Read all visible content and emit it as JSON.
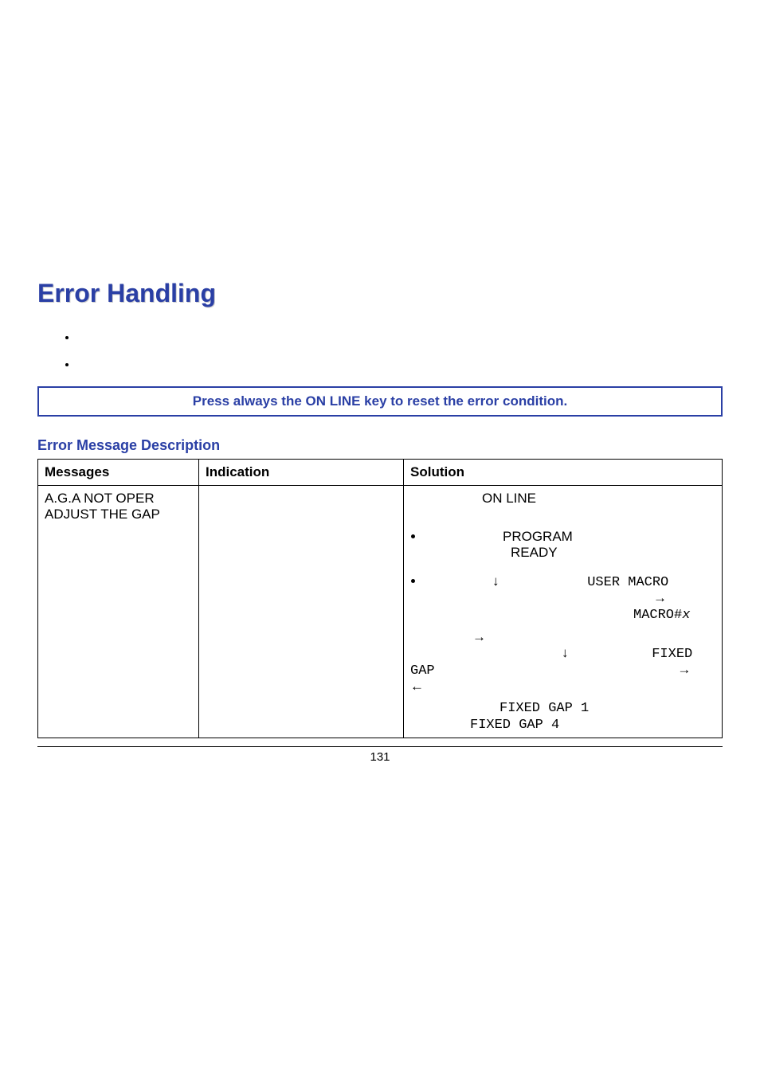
{
  "heading": "Error Handling",
  "callout": "Press always the ON LINE  key to reset the error condition.",
  "subheading": "Error Message Description",
  "table": {
    "headers": {
      "messages": "Messages",
      "indication": "Indication",
      "solution": "Solution"
    },
    "row": {
      "msg_line1": "A.G.A NOT OPER",
      "msg_line2": "ADJUST THE GAP",
      "sol_prefix": "ON LINE",
      "li1_a": "PROGRAM",
      "li1_b": "READY",
      "li2_a": "↓",
      "li2_b": "USER MACRO",
      "li2_c": "→",
      "li2_d_prefix": "MACRO#",
      "li2_d_var": "x",
      "para2_arrow1": "→",
      "para2_arrow2": "↓",
      "para2_fixed": "FIXED",
      "para2_gap": "GAP",
      "para2_arrows_rl_1": "→",
      "para2_arrows_rl_2": "←",
      "para3_a": "FIXED GAP 1",
      "para3_b": "FIXED GAP 4"
    }
  },
  "page_number": "131"
}
